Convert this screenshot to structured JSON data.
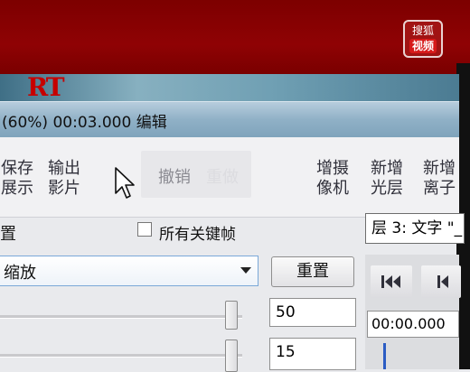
{
  "title_bar": {
    "text": "(60%) 00:03.000 编辑"
  },
  "logo": {
    "line1": "搜狐",
    "line2": "视频"
  },
  "preview": {
    "glyph": "RT"
  },
  "toolbar": {
    "save": {
      "line1": "保存",
      "line2": "展示"
    },
    "export": {
      "line1": "输出",
      "line2": "影片"
    },
    "undo": "撤销",
    "redo": "重做",
    "add_camera": {
      "line1": "增摄",
      "line2": "像机"
    },
    "new_light": {
      "line1": "新增",
      "line2": "光层"
    },
    "new_particle": {
      "line1": "新增",
      "line2": "离子"
    }
  },
  "options": {
    "label": "置",
    "all_keyframes_label": "所有关键帧",
    "all_keyframes_checked": false,
    "layer_select": "层 3: 文字 \"_"
  },
  "mode_select": {
    "value": "缩放"
  },
  "reset_label": "重置",
  "inputs": {
    "value1": "50",
    "value2": "15"
  },
  "sliders": {
    "slider1_fraction": 0.98,
    "slider2_fraction": 0.98
  },
  "playback": {
    "time": "00:00.000"
  },
  "colors": {
    "accent_red": "#8f0204",
    "title_blue": "#8fb0c6",
    "marker_blue": "#2b5cc4"
  }
}
